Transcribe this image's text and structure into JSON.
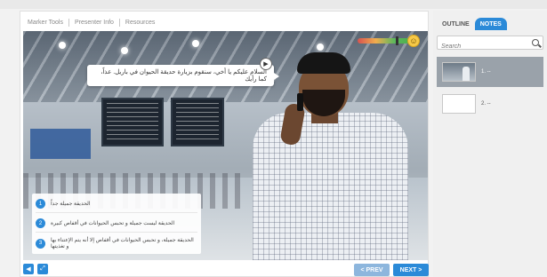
{
  "toolbar": {
    "items": [
      "Marker Tools",
      "Presenter Info",
      "Resources"
    ]
  },
  "scene": {
    "speech": "السلام عليكم يا أخي، سنقوم بزيارة حديقة الحيوان في باريل. عذاً، كما رأيك",
    "choices": [
      {
        "num": "1",
        "text": "الحديقة جميلة جداً"
      },
      {
        "num": "2",
        "text": "الحديقة ليست جميلة و تحبس الحيوانات في أقفاص كبيرة"
      },
      {
        "num": "3",
        "text": "الحديقة جميلة، و تحبس الحيوانات في أقفاص إلا أنه يتم الإعتناء بها و تغذيتها"
      }
    ],
    "meter_level": 0.7
  },
  "controls": {
    "prev_label": "< PREV",
    "next_label": "NEXT >"
  },
  "sidebar": {
    "tabs": [
      "OUTLINE",
      "NOTES"
    ],
    "active_tab": "NOTES",
    "search_placeholder": "Search",
    "slides": [
      {
        "label": "1. --"
      },
      {
        "label": "2. --"
      }
    ]
  },
  "colors": {
    "accent": "#2b8ad8"
  }
}
